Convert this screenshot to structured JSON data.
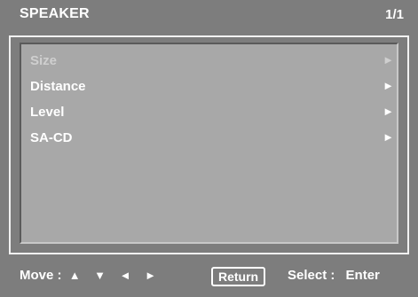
{
  "header": {
    "title": "SPEAKER",
    "page_indicator": "1/1"
  },
  "menu": {
    "items": [
      {
        "label": "Size",
        "arrow": "►",
        "enabled": false
      },
      {
        "label": "Distance",
        "arrow": "►",
        "enabled": true
      },
      {
        "label": "Level",
        "arrow": "►",
        "enabled": true
      },
      {
        "label": "SA-CD",
        "arrow": "►",
        "enabled": true
      }
    ]
  },
  "footer": {
    "move_label": "Move :",
    "move_arrows": "▲ ▼ ◄ ►",
    "return_label": "Return",
    "select_label": "Select :",
    "enter_label": "Enter"
  },
  "colors": {
    "background": "#7d7d7d",
    "panel_fill": "#a8a8a8",
    "text": "#ffffff",
    "disabled_text": "#cfcfcf"
  }
}
